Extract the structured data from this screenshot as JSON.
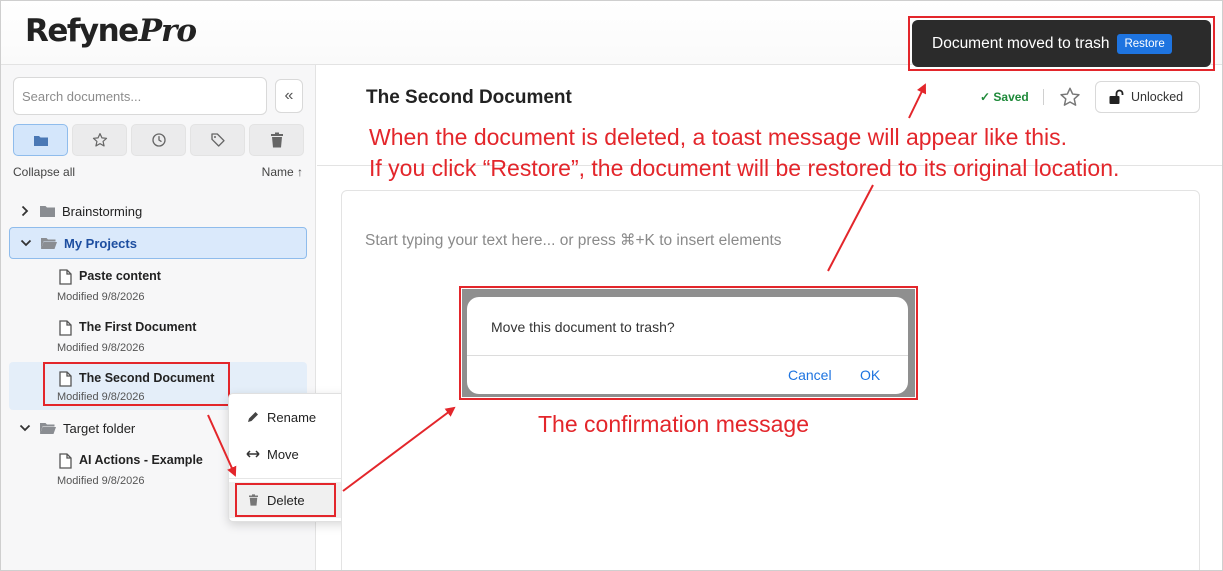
{
  "header": {
    "logo_main": "Refyne",
    "logo_pro": "Pro"
  },
  "toast": {
    "message": "Document moved to trash",
    "restore_label": "Restore"
  },
  "sidebar": {
    "search_placeholder": "Search documents...",
    "collapse_icon": "«",
    "filters": [
      {
        "icon": "folder-icon",
        "active": true
      },
      {
        "icon": "star-icon",
        "active": false
      },
      {
        "icon": "clock-icon",
        "active": false
      },
      {
        "icon": "tag-icon",
        "active": false
      },
      {
        "icon": "trash-icon",
        "active": false
      }
    ],
    "collapse_all": "Collapse all",
    "sort_label": "Name ↑",
    "tree": {
      "folder_brainstorming": "Brainstorming",
      "folder_my_projects": "My Projects",
      "doc1_title": "Paste content",
      "doc1_modified": "Modified 9/8/2026",
      "doc2_title": "The First Document",
      "doc2_modified": "Modified 9/8/2026",
      "doc3_title": "The Second Document",
      "doc3_modified": "Modified 9/8/2026",
      "folder_target": "Target folder",
      "doc4_title": "AI Actions - Example",
      "doc4_modified": "Modified 9/8/2026"
    }
  },
  "context_menu": {
    "rename": "Rename",
    "move": "Move",
    "delete": "Delete"
  },
  "document": {
    "title": "The Second Document",
    "saved": "✓ Saved",
    "lock_label": "Unlocked",
    "editor_placeholder": "Start typing your text here... or press ⌘+K to insert elements"
  },
  "dialog": {
    "message": "Move this document to trash?",
    "cancel": "Cancel",
    "ok": "OK"
  },
  "annotations": {
    "toast_line1": "When the document is deleted, a toast message will appear like this.",
    "toast_line2": "If you click “Restore”, the document will be restored to its original location.",
    "confirm": "The confirmation message"
  },
  "colors": {
    "annotation_red": "#e3262b",
    "accent_blue": "#1e74e0",
    "selected_folder_bg": "#dae9fb",
    "toast_bg": "#2b2b2b",
    "saved_green": "#1f8a3a"
  }
}
